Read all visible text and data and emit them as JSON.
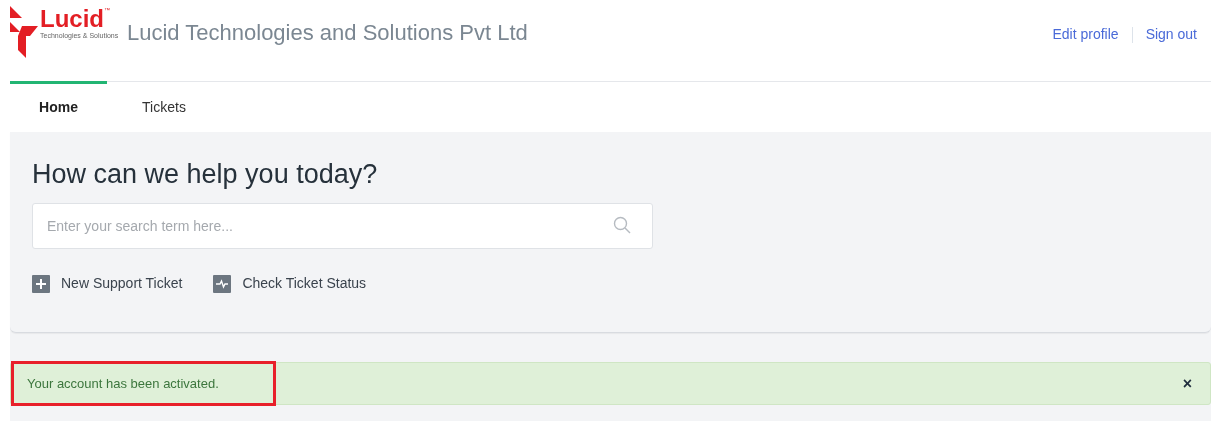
{
  "logo": {
    "wordmark": "Lucid",
    "trademark": "™",
    "tagline": "Technologies & Solutions"
  },
  "company_name": "Lucid Technologies and Solutions Pvt Ltd",
  "user_links": [
    "Edit profile",
    "Sign out"
  ],
  "tabs": [
    {
      "label": "Home",
      "selected": true
    },
    {
      "label": "Tickets",
      "selected": false
    }
  ],
  "hero": {
    "heading": "How can we help you today?",
    "search": {
      "placeholder": "Enter your search term here..."
    },
    "actions": [
      {
        "kind": "new",
        "label": "New Support Ticket"
      },
      {
        "kind": "status",
        "label": "Check Ticket Status"
      }
    ]
  },
  "alert": {
    "message": "Your account has been activated.",
    "highlighted": true,
    "close": "×"
  }
}
